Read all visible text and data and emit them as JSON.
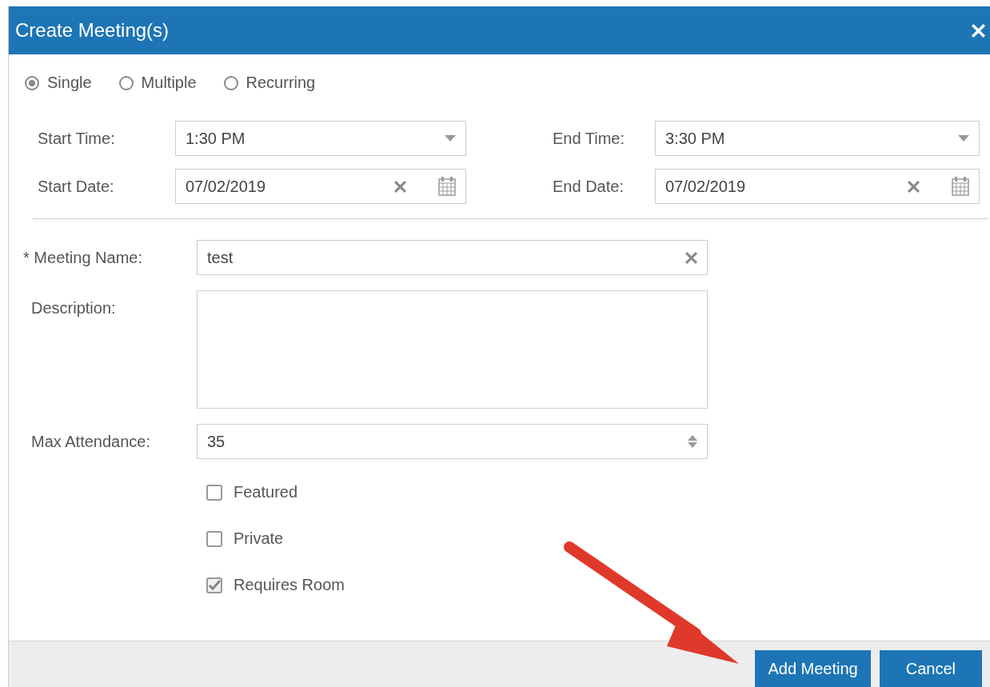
{
  "dialog": {
    "title": "Create Meeting(s)"
  },
  "modes": [
    {
      "label": "Single",
      "selected": true
    },
    {
      "label": "Multiple",
      "selected": false
    },
    {
      "label": "Recurring",
      "selected": false
    }
  ],
  "schedule": [
    {
      "label": "Start Time:",
      "value": "1:30 PM",
      "kind": "dropdown"
    },
    {
      "label": "End Time:",
      "value": "3:30 PM",
      "kind": "dropdown"
    },
    {
      "label": "Start Date:",
      "value": "07/02/2019",
      "kind": "date"
    },
    {
      "label": "End Date:",
      "value": "07/02/2019",
      "kind": "date"
    }
  ],
  "meeting_name": {
    "marker": "*",
    "label": "Meeting Name:",
    "value": "test"
  },
  "description": {
    "label": "Description:"
  },
  "max_attendance": {
    "label": "Max Attendance:",
    "value": "35"
  },
  "options": [
    {
      "label": "Featured",
      "checked": false
    },
    {
      "label": "Private",
      "checked": false
    },
    {
      "label": "Requires Room",
      "checked": true
    }
  ],
  "buttons": [
    {
      "label": "Add Meeting"
    },
    {
      "label": "Cancel"
    }
  ]
}
